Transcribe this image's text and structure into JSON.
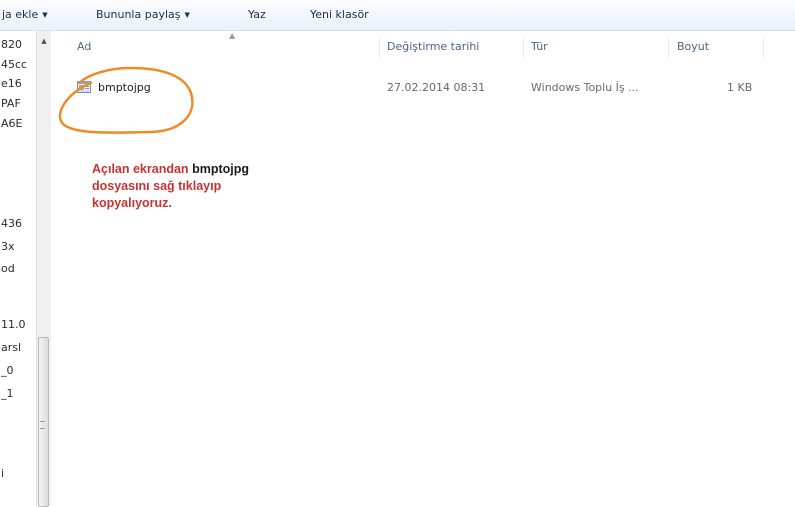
{
  "toolbar": {
    "add_to_library": "ja ekle",
    "share_with": "Bununla paylaş",
    "burn": "Yaz",
    "new_folder": "Yeni klasör"
  },
  "nav": {
    "items": [
      "820",
      "45cc",
      "e16",
      "PAF",
      "A6E",
      "436",
      "3x",
      "od",
      "11.0",
      "arsl",
      "_0",
      "_1",
      "i"
    ]
  },
  "columns": {
    "name": "Ad",
    "date": "Değiştirme tarihi",
    "type": "Tür",
    "size": "Boyut"
  },
  "files": [
    {
      "name": "bmptojpg",
      "date": "27.02.2014 08:31",
      "type": "Windows Toplu İş ...",
      "size": "1 KB"
    }
  ],
  "annotation": {
    "part1": "Açılan ekrandan",
    "highlight": "bmptojpg",
    "part2": "dosyasını sağ tıklayıp",
    "part3": "kopyalıyoruz."
  },
  "colors": {
    "annotation_red": "#c9332f",
    "circle_orange": "#f08a24",
    "toolbar_bg": "#e9f1fa"
  }
}
